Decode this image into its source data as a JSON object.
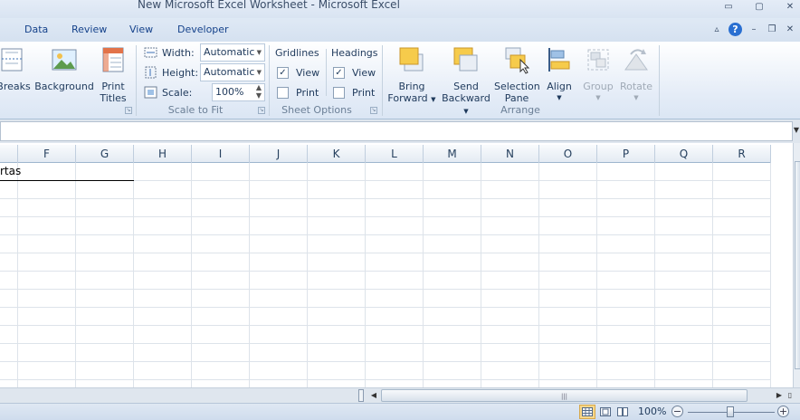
{
  "window": {
    "title": "New Microsoft Excel Worksheet  -  Microsoft Excel",
    "minimize_icon": "▭",
    "restore_icon": "▢",
    "close_icon": "✕"
  },
  "tabs": [
    {
      "label": "Data"
    },
    {
      "label": "Review"
    },
    {
      "label": "View"
    },
    {
      "label": "Developer"
    }
  ],
  "ribbon": {
    "page_setup": {
      "breaks_label": "Breaks",
      "background_label": "Background",
      "print_titles_line1": "Print",
      "print_titles_line2": "Titles"
    },
    "scale_to_fit": {
      "width_label": "Width:",
      "width_value": "Automatic",
      "height_label": "Height:",
      "height_value": "Automatic",
      "scale_label": "Scale:",
      "scale_value": "100%",
      "group_label": "Scale to Fit"
    },
    "sheet_options": {
      "gridlines_label": "Gridlines",
      "headings_label": "Headings",
      "view_label": "View",
      "print_label": "Print",
      "gridlines_view_checked": true,
      "gridlines_print_checked": false,
      "headings_view_checked": true,
      "headings_print_checked": false,
      "group_label": "Sheet Options"
    },
    "arrange": {
      "bring_forward_line1": "Bring",
      "bring_forward_line2": "Forward",
      "send_backward_line1": "Send",
      "send_backward_line2": "Backward",
      "selection_pane_line1": "Selection",
      "selection_pane_line2": "Pane",
      "align_label": "Align",
      "group_btn_label": "Group",
      "rotate_label": "Rotate",
      "group_label": "Arrange"
    }
  },
  "columns": [
    "F",
    "G",
    "H",
    "I",
    "J",
    "K",
    "L",
    "M",
    "N",
    "O",
    "P",
    "Q",
    "R"
  ],
  "cells": {
    "row1_text": "rtas"
  },
  "status": {
    "zoom": "100%"
  },
  "colors": {
    "accent": "#15428b",
    "ribbon_bg": "#dbe6f4",
    "grid_line": "#dde3ea"
  }
}
